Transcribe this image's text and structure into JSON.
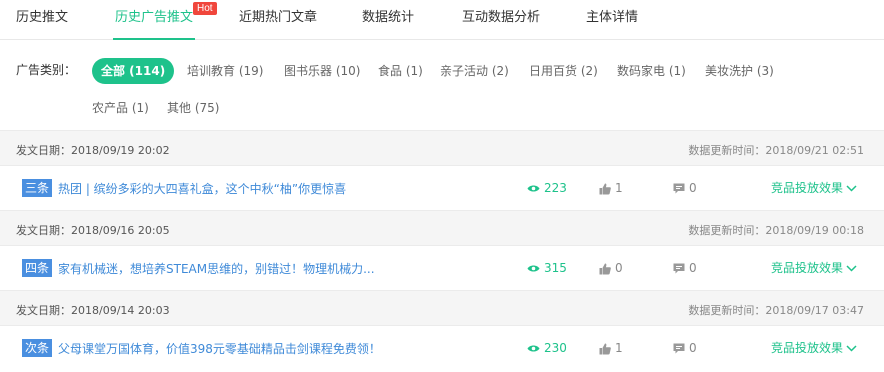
{
  "tabs": [
    {
      "label": "历史推文"
    },
    {
      "label": "历史广告推文",
      "badge": "Hot"
    },
    {
      "label": "近期热门文章"
    },
    {
      "label": "数据统计"
    },
    {
      "label": "互动数据分析"
    },
    {
      "label": "主体详情"
    }
  ],
  "filter": {
    "label": "广告类别：",
    "categories": [
      {
        "label": "全部 (114)",
        "active": true
      },
      {
        "label": "培训教育 (19)"
      },
      {
        "label": "图书乐器 (10)"
      },
      {
        "label": "食品 (1)"
      },
      {
        "label": "亲子活动 (2)"
      },
      {
        "label": "日用百货 (2)"
      },
      {
        "label": "数码家电 (1)"
      },
      {
        "label": "美妆洗护 (3)"
      },
      {
        "label": "农产品 (1)"
      },
      {
        "label": "其他 (75)"
      }
    ]
  },
  "groups": [
    {
      "pub_date": "发文日期：2018/09/19 20:02",
      "update_time": "数据更新时间：2018/09/21 02:51",
      "article": {
        "badge": "三条",
        "title": "热团 | 缤纷多彩的大四喜礼盒，这个中秋“柚”你更惊喜",
        "views": "223",
        "likes": "1",
        "comments": "0",
        "effect": "竞品投放效果"
      }
    },
    {
      "pub_date": "发文日期：2018/09/16 20:05",
      "update_time": "数据更新时间：2018/09/19 00:18",
      "article": {
        "badge": "四条",
        "title": "家有机械迷，想培养STEAM思维的，别错过！物理机械力...",
        "views": "315",
        "likes": "0",
        "comments": "0",
        "effect": "竞品投放效果"
      }
    },
    {
      "pub_date": "发文日期：2018/09/14 20:03",
      "update_time": "数据更新时间：2018/09/17 03:47",
      "article": {
        "badge": "次条",
        "title": "父母课堂万国体育，价值398元零基础精品击剑课程免费领！",
        "views": "230",
        "likes": "1",
        "comments": "0",
        "effect": "竞品投放效果"
      }
    }
  ],
  "colors": {
    "accent": "#1ec28b",
    "link": "#3f8ad8",
    "badge_blue": "#4a8fe0",
    "hot": "#f0463c"
  },
  "icons": {
    "views": "eye-icon",
    "likes": "thumbs-up-icon",
    "comments": "comment-icon",
    "effect": "chevron-down-icon"
  }
}
